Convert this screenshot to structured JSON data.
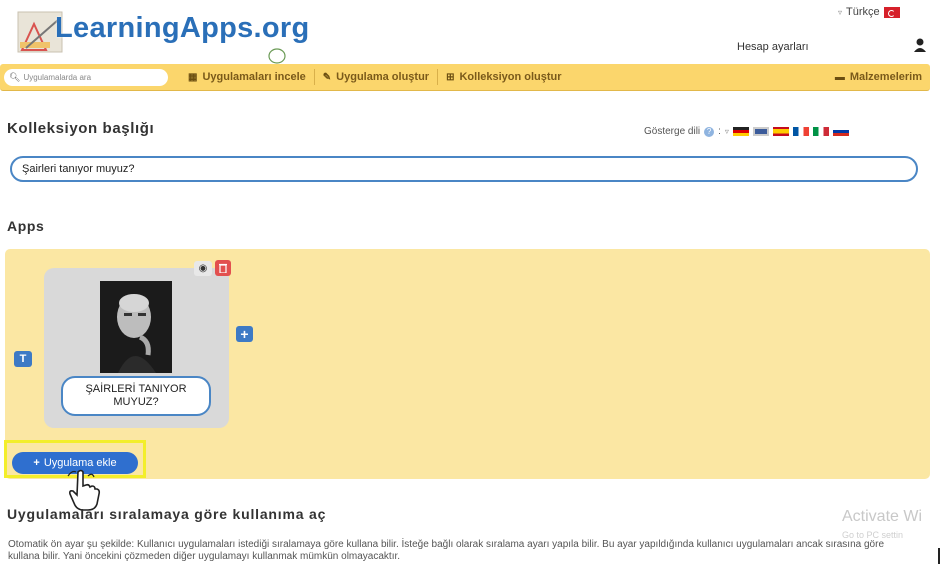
{
  "header": {
    "logo_text": "LearningApps.org",
    "language": "Türkçe",
    "account_label": "Hesap ayarları"
  },
  "nav": {
    "search_placeholder": "Uygulamalarda ara",
    "items": [
      {
        "label": "Uygulamaları incele",
        "icon": "grid-icon"
      },
      {
        "label": "Uygulama oluştur",
        "icon": "pencil-icon"
      },
      {
        "label": "Kolleksiyon oluştur",
        "icon": "collection-icon"
      }
    ],
    "materials_label": "Malzemelerim"
  },
  "collection": {
    "title_label": "Kolleksiyon başlığı",
    "lang_indicator_label": "Gösterge dili",
    "help_mark": "?",
    "title_value": "Şairleri tanıyor muyuz?"
  },
  "apps": {
    "section_label": "Apps",
    "card_label": "ŞAİRLERİ TANIYOR MUYUZ?",
    "add_button_label": "Uygulama ekle",
    "text_button_glyph": "T",
    "plus_glyph": "+"
  },
  "order": {
    "title": "Uygulamaları sıralamaya göre kullanıma aç",
    "description": "Otomatik ön ayar şu şekilde: Kullanıcı uygulamaları istediği sıralamaya göre kullana bilir. İsteğe bağlı olarak sıralama ayarı yapıla bilir. Bu ayar yapıldığında kullanıcı uygulamaları ancak sırasına göre kullana bilir. Yani öncekini çözmeden diğer uygulamayı kullanmak mümkün olmayacaktır."
  },
  "watermark": {
    "line1": "Activate Wi",
    "line2": "Go to PC settin"
  },
  "colors": {
    "nav_bg": "#fbd66c",
    "apps_bg": "#fbe7a3",
    "accent_blue": "#2f6fcf",
    "highlight": "#f3ee2a"
  }
}
